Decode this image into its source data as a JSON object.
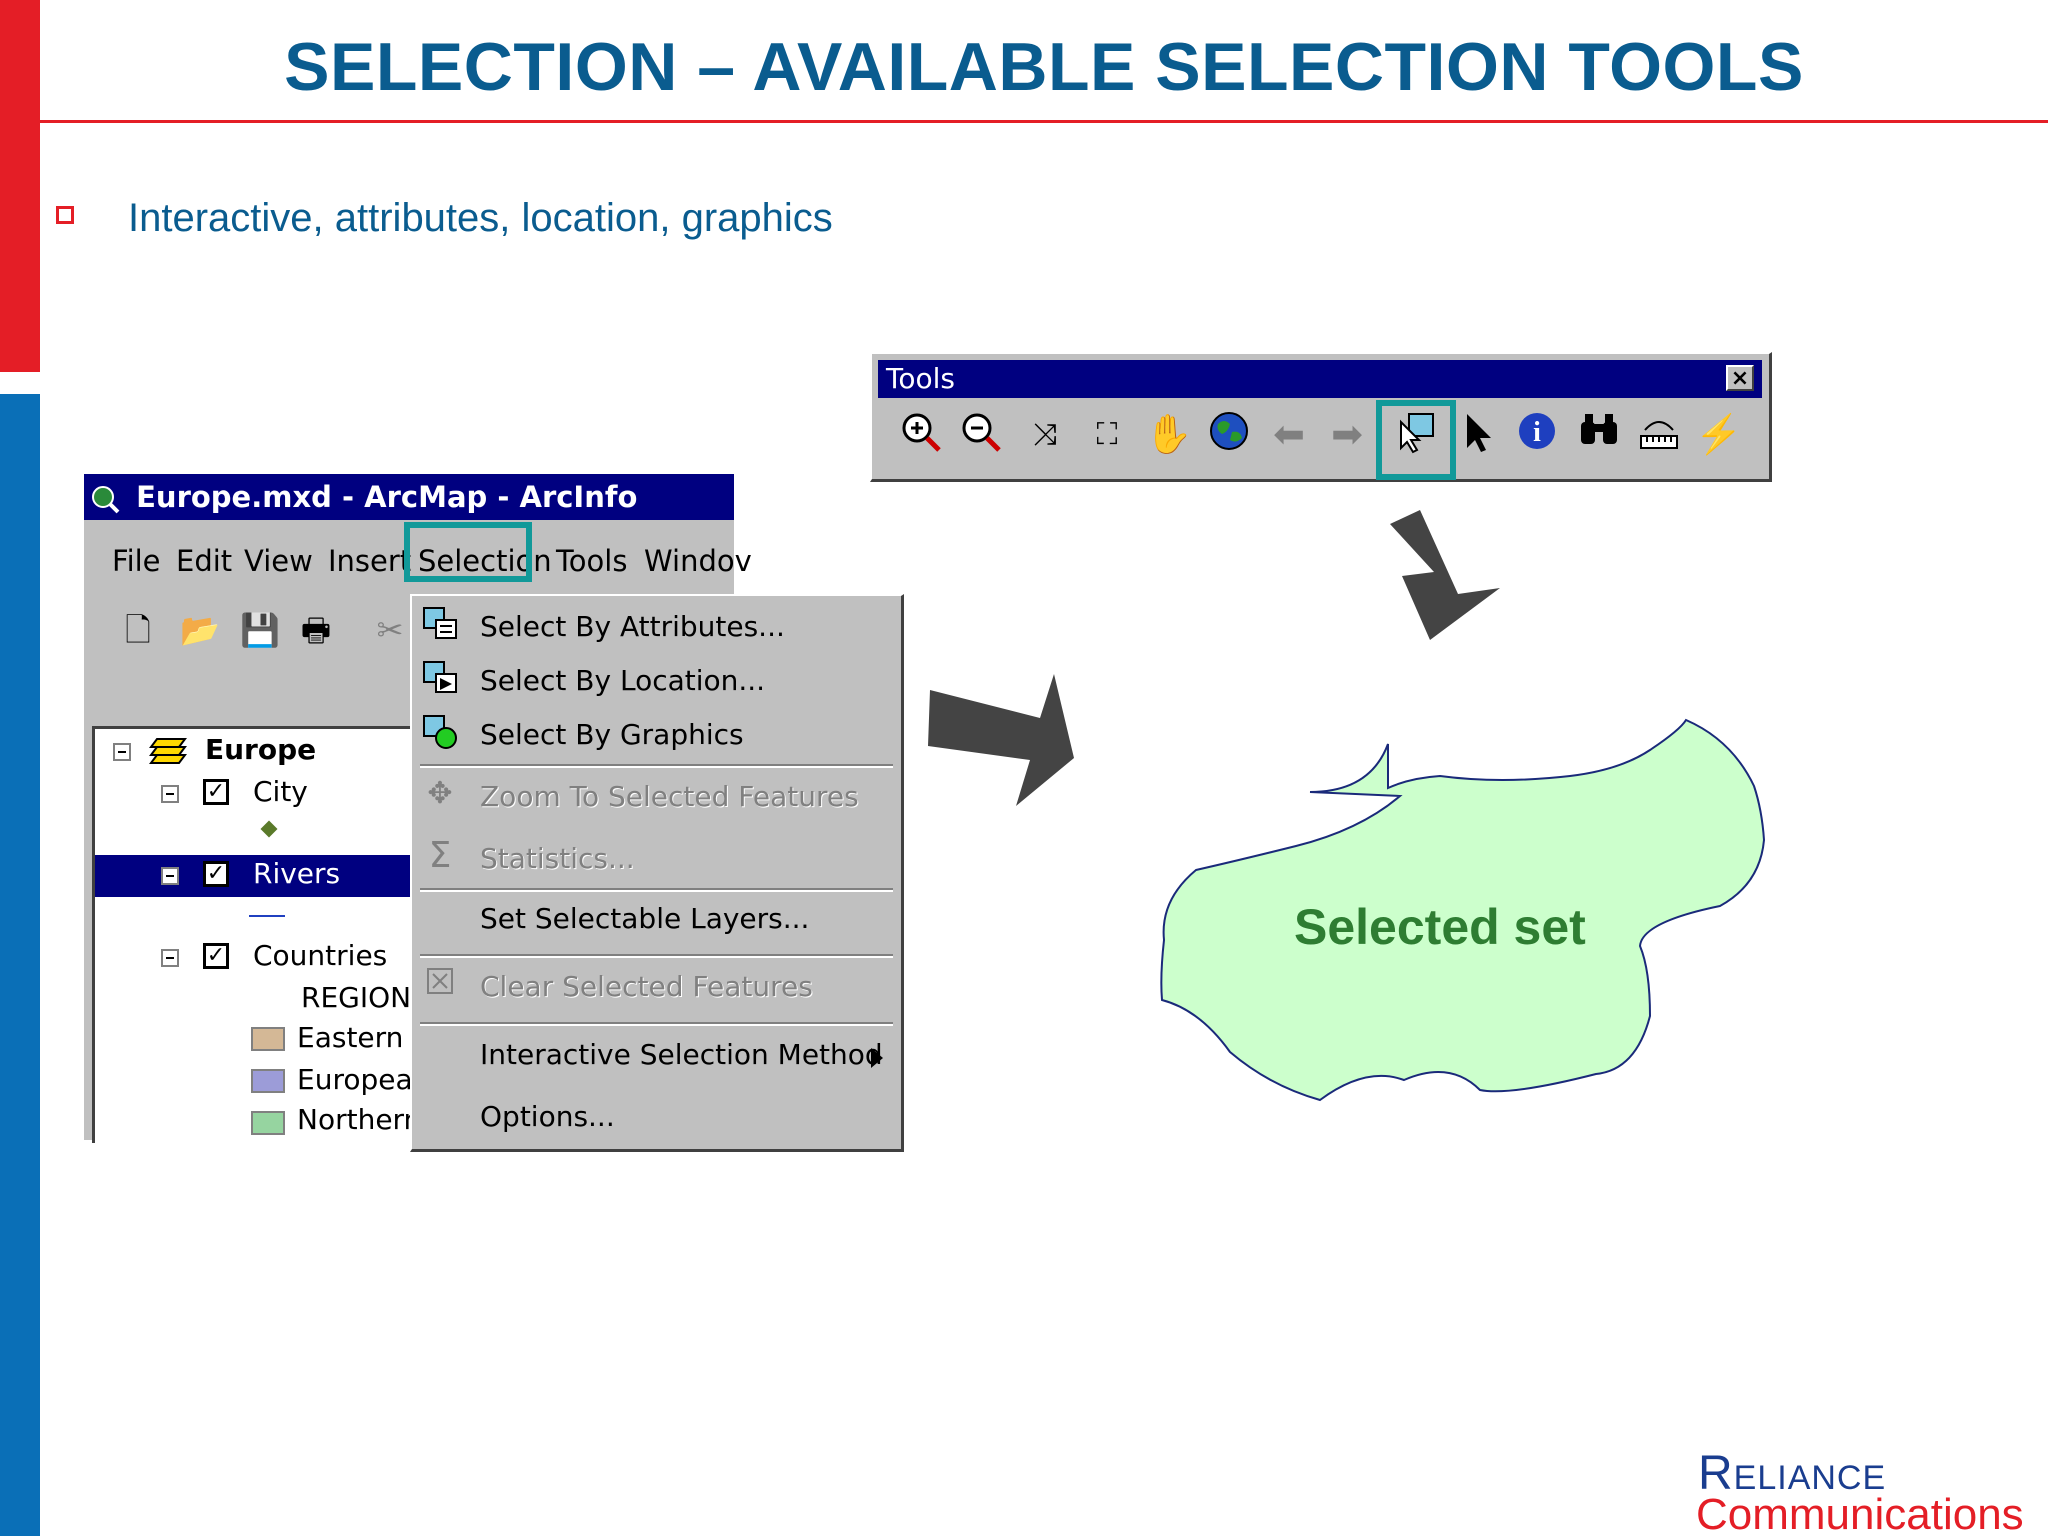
{
  "slide": {
    "title": "SELECTION – AVAILABLE SELECTION TOOLS",
    "bullet": "Interactive, attributes, location, graphics",
    "selected_label": "Selected set"
  },
  "arcmap": {
    "window_title": "Europe.mxd - ArcMap - ArcInfo",
    "menu": [
      "File",
      "Edit",
      "View",
      "Insert",
      "Selection",
      "Tools",
      "Windov"
    ],
    "toolbar_icons": [
      "new-document-icon",
      "open-folder-icon",
      "save-icon",
      "print-icon",
      "cut-icon"
    ],
    "toc": {
      "root": "Europe",
      "layers": [
        {
          "name": "City",
          "checked": true
        },
        {
          "name": "Rivers",
          "checked": true,
          "selected": true
        },
        {
          "name": "Countries",
          "checked": true
        }
      ],
      "region_heading": "REGION",
      "legend": [
        {
          "label": "Eastern E",
          "color": "#d4b896"
        },
        {
          "label": "Europear",
          "color": "#9c9cd8"
        },
        {
          "label": "Northern",
          "color": "#96d4a0"
        }
      ]
    }
  },
  "selection_menu": {
    "items": [
      {
        "label": "Select By Attributes...",
        "enabled": true,
        "icon": "select-by-attributes-icon"
      },
      {
        "label": "Select By Location...",
        "enabled": true,
        "icon": "select-by-location-icon"
      },
      {
        "label": "Select By Graphics",
        "enabled": true,
        "icon": "select-by-graphics-icon"
      },
      {
        "label": "Zoom To Selected Features",
        "enabled": false,
        "icon": "zoom-to-selected-icon"
      },
      {
        "label": "Statistics...",
        "enabled": false,
        "icon": "statistics-sigma-icon"
      },
      {
        "label": "Set Selectable Layers...",
        "enabled": true
      },
      {
        "label": "Clear Selected Features",
        "enabled": false,
        "icon": "clear-selection-icon"
      },
      {
        "label": "Interactive Selection Method",
        "enabled": true,
        "submenu": true
      },
      {
        "label": "Options...",
        "enabled": true
      }
    ]
  },
  "tools_toolbar": {
    "title": "Tools",
    "close": "×",
    "tools": [
      "zoom-in-icon",
      "zoom-out-icon",
      "fixed-zoom-in-icon",
      "fixed-zoom-out-icon",
      "pan-hand-icon",
      "full-extent-globe-icon",
      "back-arrow-icon",
      "forward-arrow-icon",
      "select-features-icon",
      "select-elements-pointer-icon",
      "identify-icon",
      "find-binoculars-icon",
      "measure-icon",
      "hyperlink-lightning-icon"
    ]
  },
  "branding": {
    "line1": "Reliance",
    "line2": "Communications"
  },
  "colors": {
    "brand_red": "#e41e26",
    "brand_blue": "#0a6fb7",
    "title_blue": "#0a5c8f",
    "highlight_teal": "#119999",
    "selected_fill": "#ccffcc",
    "selected_text": "#2e7d32"
  }
}
